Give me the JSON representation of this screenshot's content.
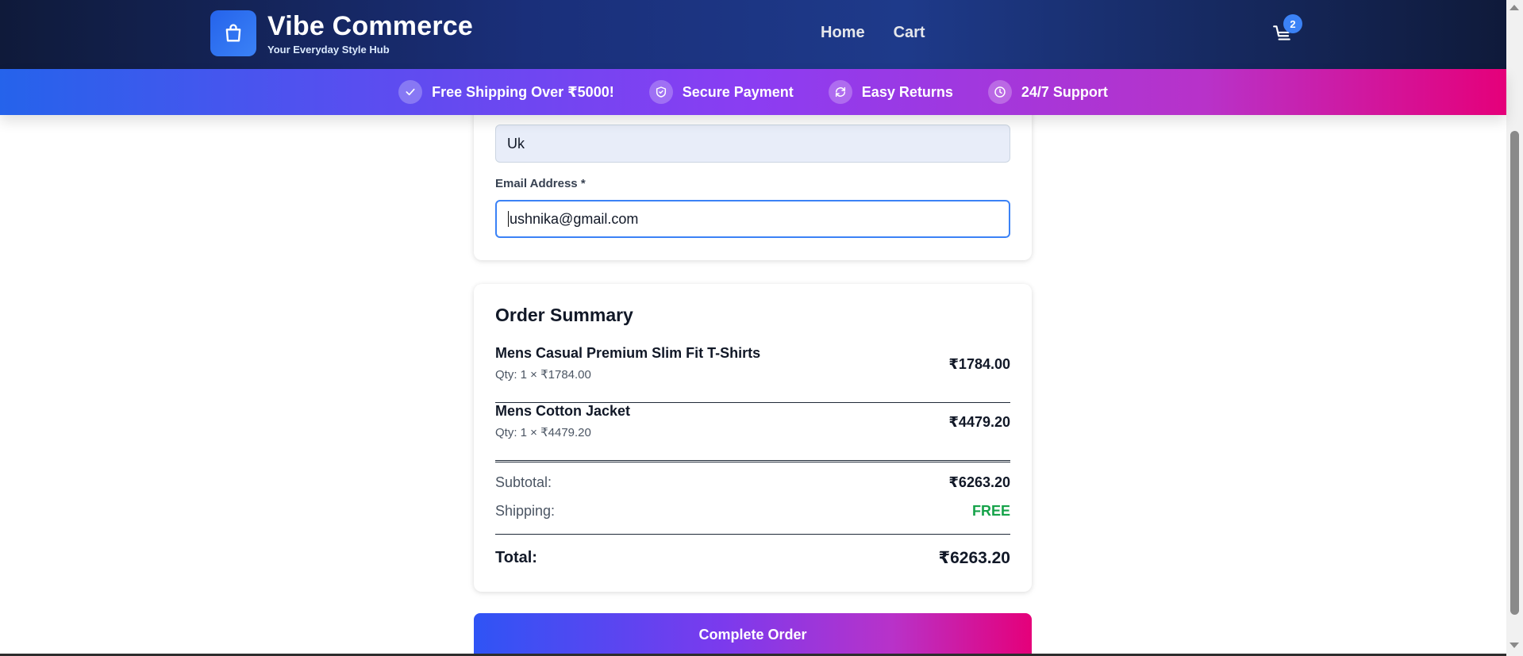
{
  "header": {
    "brand_name": "Vibe Commerce",
    "brand_tagline": "Your Everyday Style Hub",
    "logo_icon": "shopping-bag-icon",
    "nav": [
      {
        "label": "Home"
      },
      {
        "label": "Cart"
      }
    ],
    "cart_icon": "cart-icon",
    "cart_count": "2"
  },
  "banner": {
    "features": [
      {
        "icon": "check-icon",
        "label": "Free Shipping Over ₹5000!"
      },
      {
        "icon": "shield-icon",
        "label": "Secure Payment"
      },
      {
        "icon": "refresh-icon",
        "label": "Easy Returns"
      },
      {
        "icon": "clock-icon",
        "label": "24/7 Support"
      }
    ]
  },
  "form": {
    "name_value": "Uk",
    "email_label": "Email Address *",
    "email_value": "ushnika@gmail.com"
  },
  "summary": {
    "title": "Order Summary",
    "items": [
      {
        "name": "Mens Casual Premium Slim Fit T-Shirts",
        "qty_text": "Qty: 1 × ₹1784.00",
        "price": "₹1784.00"
      },
      {
        "name": "Mens Cotton Jacket",
        "qty_text": "Qty: 1 × ₹4479.20",
        "price": "₹4479.20"
      }
    ],
    "subtotal_label": "Subtotal:",
    "subtotal_value": "₹6263.20",
    "shipping_label": "Shipping:",
    "shipping_value": "FREE",
    "total_label": "Total:",
    "total_value": "₹6263.20"
  },
  "actions": {
    "complete_label": "Complete Order"
  },
  "colors": {
    "accent": "#3b82f6",
    "free_green": "#16a34a",
    "gradient_start": "#2563eb",
    "gradient_end": "#e5007a"
  }
}
